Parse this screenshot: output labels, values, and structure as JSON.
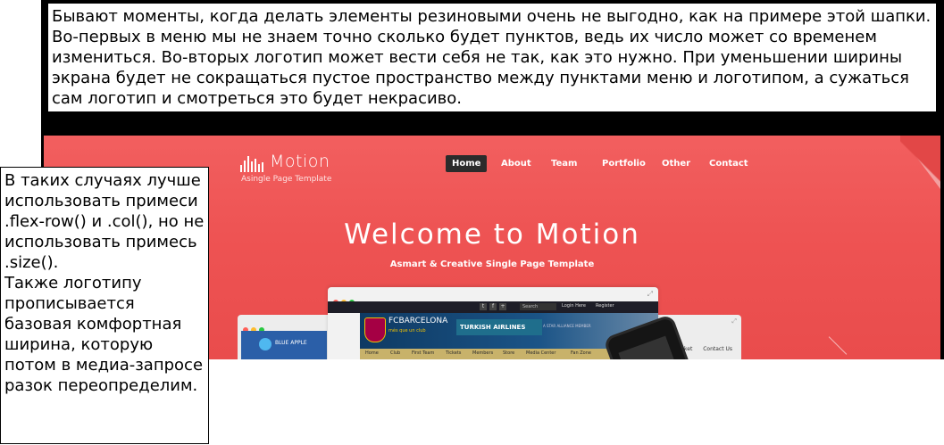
{
  "note_top": {
    "text": "Бывают моменты, когда делать элементы резиновыми очень не выгодно, как на примере этой шапки. Во-первых в меню мы не знаем точно сколько будет пунктов, ведь их число может со временем измениться. Во-вторых логотип может вести себя не так, как это нужно. При уменьшении ширины экрана будет не сокращаться пустое пространство между пунктами меню и логотипом, а сужаться сам логотип и смотреться это будет некрасиво."
  },
  "note_left": {
    "text_1": "В таких случаях лучше использовать примеси .flex-row() и .col(), но не использовать примесь .size().",
    "text_2": "Также логотипу прописывается базовая комфортная ширина, которую потом в медиа-запросе разок переопределим."
  },
  "template": {
    "logo": {
      "name": "Motion",
      "tagline": "Asingle Page Template"
    },
    "nav": {
      "items": [
        "Home",
        "About",
        "Team",
        "Portfolio",
        "Other",
        "Contact"
      ],
      "active": "Home"
    },
    "hero": {
      "title": "Welcome to Motion",
      "subtitle": "Asmart & Creative Single Page Template"
    },
    "mockup": {
      "back_logo": "BLUE APPLE",
      "back_links": [
        "...sket",
        "Contact Us"
      ],
      "social": [
        "t",
        "f",
        "+"
      ],
      "login": "Login Here",
      "register": "Register",
      "search": "Search",
      "club": "FCBARCELONA",
      "motto": "més que un club",
      "sponsor": "TURKISH AIRLINES",
      "alliance": "A STAR ALLIANCE MEMBER",
      "site_nav": [
        "Home",
        "Club",
        "First Team",
        "Tickets",
        "Members",
        "Store",
        "Media Center",
        "Fan Zone"
      ]
    },
    "colors": {
      "background": "#f05757",
      "nav_active": "#2b2b2b",
      "text": "#ffffff"
    }
  }
}
